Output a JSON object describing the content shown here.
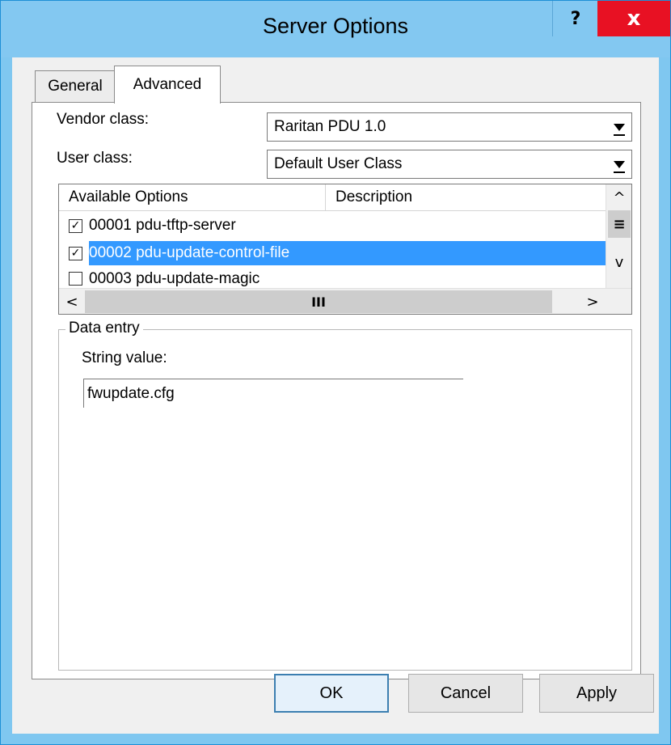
{
  "window": {
    "title": "Server Options",
    "help_glyph": "?",
    "close_glyph": "x"
  },
  "tabs": [
    {
      "label": "General",
      "active": false
    },
    {
      "label": "Advanced",
      "active": true
    }
  ],
  "vendor_class": {
    "label": "Vendor class:",
    "value": "Raritan PDU 1.0"
  },
  "user_class": {
    "label": "User class:",
    "value": "Default User Class"
  },
  "options_list": {
    "columns": [
      "Available Options",
      "Description"
    ],
    "rows": [
      {
        "checked": true,
        "text": "00001 pdu-tftp-server",
        "selected": false
      },
      {
        "checked": true,
        "text": "00002 pdu-update-control-file",
        "selected": true
      },
      {
        "checked": false,
        "text": "00003 pdu-update-magic",
        "selected": false
      }
    ],
    "scroll": {
      "up": "^",
      "down": "v",
      "left": "<",
      "right": ">",
      "thumb_v": "≡",
      "thumb_h": "III"
    }
  },
  "data_entry": {
    "legend": "Data entry",
    "string_label": "String value:",
    "string_value": "fwupdate.cfg"
  },
  "buttons": {
    "ok": "OK",
    "cancel": "Cancel",
    "apply": "Apply"
  },
  "colors": {
    "titlebar": "#83c8f1",
    "close": "#e81123",
    "selection": "#3399ff"
  }
}
